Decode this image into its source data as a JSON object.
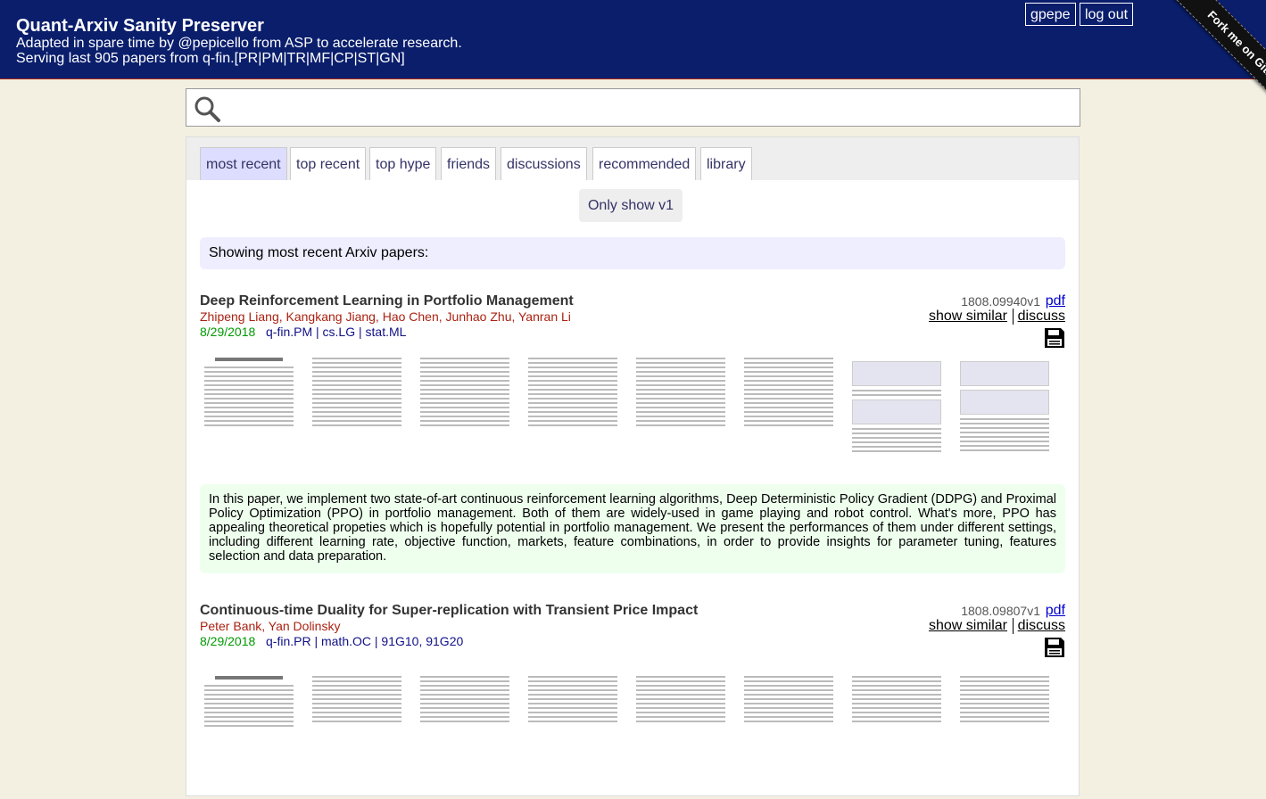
{
  "header": {
    "title": "Quant-Arxiv Sanity Preserver",
    "tagline1": "Adapted in spare time by @pepicello from ASP to accelerate research.",
    "tagline2": "Serving last 905 papers from q-fin.[PR|PM|TR|MF|CP|ST|GN]",
    "user": "gpepe",
    "logout": "log out",
    "fork_label": "Fork me on GitHub"
  },
  "search": {
    "value": "",
    "placeholder": ""
  },
  "tabs": [
    {
      "label": "most recent",
      "active": true
    },
    {
      "label": "top recent",
      "active": false
    },
    {
      "label": "top hype",
      "active": false
    },
    {
      "label": "friends",
      "active": false
    },
    {
      "label": "discussions",
      "active": false
    },
    {
      "label": "recommended",
      "active": false
    },
    {
      "label": "library",
      "active": false
    }
  ],
  "v1_button": "Only show v1",
  "showing_label": "Showing most recent Arxiv papers:",
  "papers": [
    {
      "title": "Deep Reinforcement Learning in Portfolio Management",
      "authors": "Zhipeng Liang, Kangkang Jiang, Hao Chen, Junhao Zhu, Yanran Li",
      "date": "8/29/2018",
      "categories": "q-fin.PM | cs.LG | stat.ML",
      "arxiv_id": "1808.09940v1",
      "pdf": "pdf",
      "show_similar": "show similar",
      "discuss": "discuss",
      "abstract": "In this paper, we implement two state-of-art continuous reinforcement learning algorithms, Deep Deterministic Policy Gradient (DDPG) and Proximal Policy Optimization (PPO) in portfolio management. Both of them are widely-used in game playing and robot control. What's more, PPO has appealing theoretical propeties which is hopefully potential in portfolio management. We present the performances of them under different settings, including different learning rate, objective function, markets, feature combinations, in order to provide insights for parameter tuning, features selection and data preparation."
    },
    {
      "title": "Continuous-time Duality for Super-replication with Transient Price Impact",
      "authors": "Peter Bank, Yan Dolinsky",
      "date": "8/29/2018",
      "categories": "q-fin.PR | math.OC | 91G10, 91G20",
      "arxiv_id": "1808.09807v1",
      "pdf": "pdf",
      "show_similar": "show similar",
      "discuss": "discuss"
    }
  ],
  "colors": {
    "header_bg": "#0a1e6c",
    "page_bg": "#f3f0e2",
    "active_tab": "#ddf",
    "authors": "#a21",
    "date": "#090",
    "abstract_bg": "#efe"
  },
  "icons": [
    "search-icon",
    "save-icon"
  ]
}
